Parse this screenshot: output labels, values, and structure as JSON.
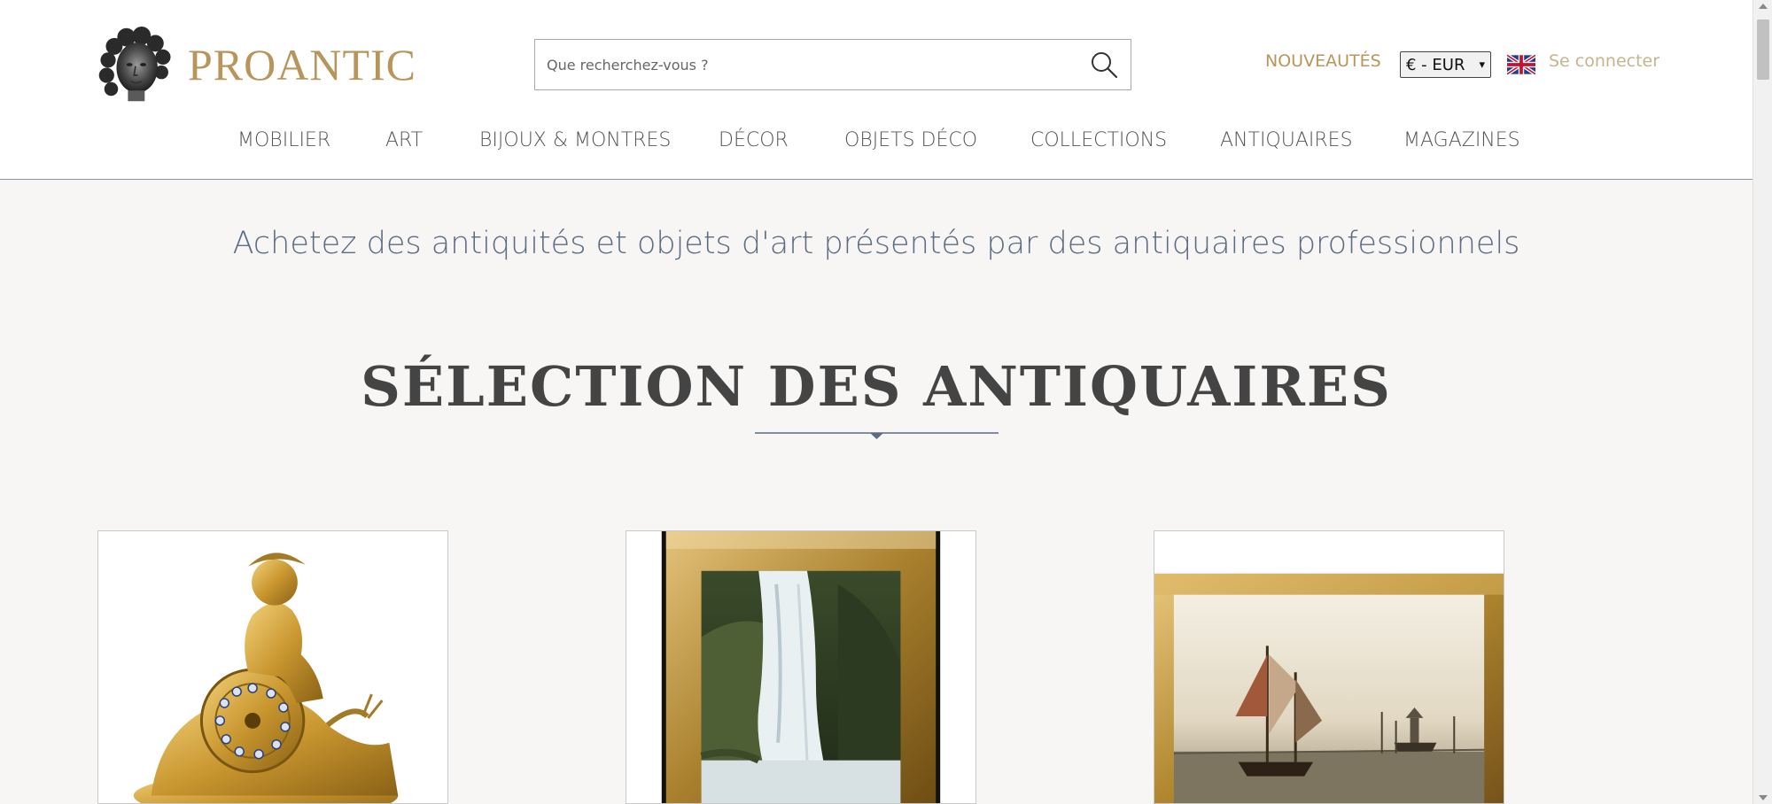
{
  "header": {
    "logo_text": "PROANTIC",
    "search": {
      "placeholder": "Que recherchez-vous ?"
    },
    "nouveautes_label": "NOUVEAUTÉS",
    "currency": "€ - EUR",
    "language_flag": "uk-flag-icon",
    "login_label": "Se connecter"
  },
  "nav": {
    "items": [
      {
        "label": "MOBILIER"
      },
      {
        "label": "ART"
      },
      {
        "label": "BIJOUX & MONTRES"
      },
      {
        "label": "DÉCOR"
      },
      {
        "label": "OBJETS DÉCO"
      },
      {
        "label": "COLLECTIONS"
      },
      {
        "label": "ANTIQUAIRES"
      },
      {
        "label": "MAGAZINES"
      }
    ]
  },
  "main": {
    "tagline": "Achetez des antiquités et objets d'art présentés par des antiquaires professionnels",
    "section_title": "SÉLECTION DES ANTIQUAIRES",
    "cards": [
      {
        "subject": "gilded bronze clock with child on snail"
      },
      {
        "subject": "waterfall painting in gilt frame"
      },
      {
        "subject": "sailing ship painting in gilt frame"
      }
    ]
  },
  "colors": {
    "brand_gold": "#b8955a",
    "nav_text": "#555555",
    "tagline_blue": "#5b6c84",
    "background": "#f7f6f4"
  }
}
